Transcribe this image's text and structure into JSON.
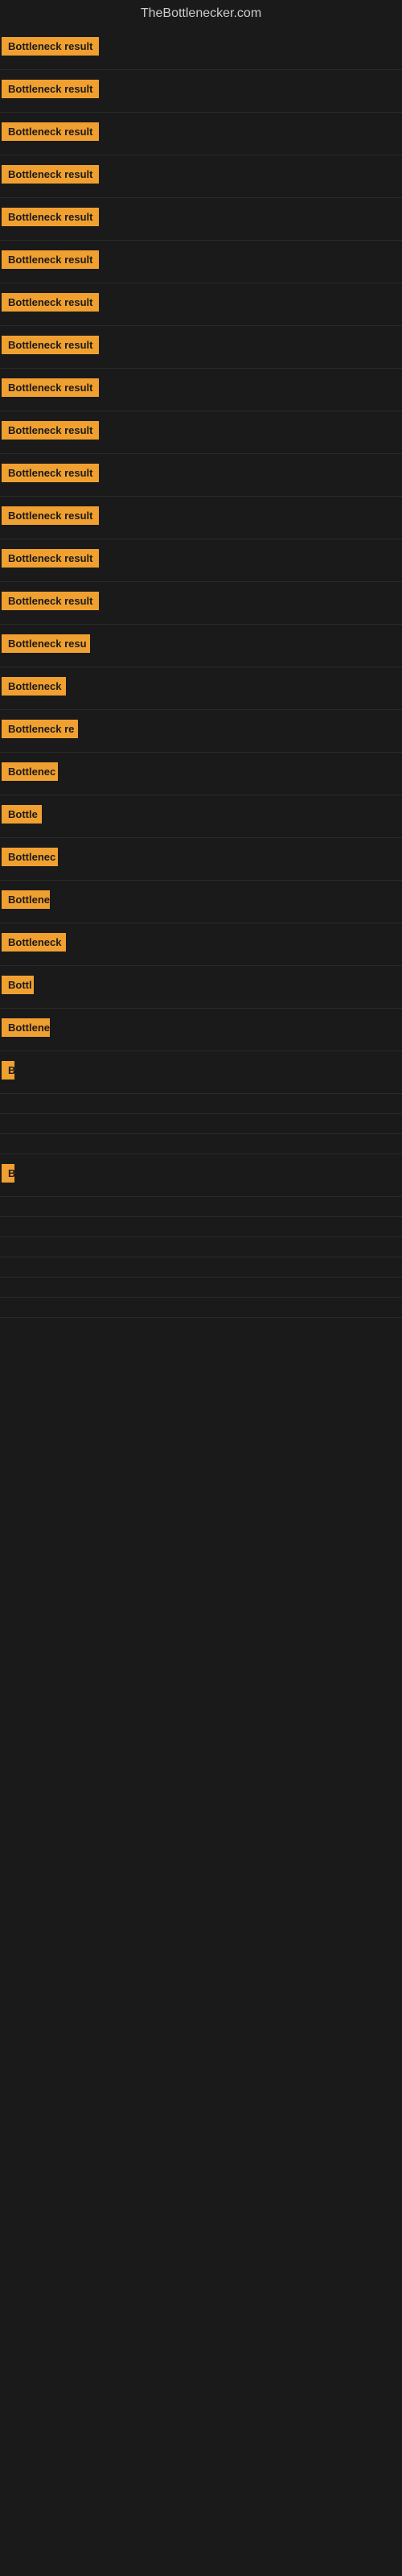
{
  "site": {
    "title": "TheBottlenecker.com"
  },
  "rows": [
    {
      "label": "Bottleneck result",
      "width": 130
    },
    {
      "label": "Bottleneck result",
      "width": 130
    },
    {
      "label": "Bottleneck result",
      "width": 130
    },
    {
      "label": "Bottleneck result",
      "width": 130
    },
    {
      "label": "Bottleneck result",
      "width": 130
    },
    {
      "label": "Bottleneck result",
      "width": 130
    },
    {
      "label": "Bottleneck result",
      "width": 130
    },
    {
      "label": "Bottleneck result",
      "width": 130
    },
    {
      "label": "Bottleneck result",
      "width": 130
    },
    {
      "label": "Bottleneck result",
      "width": 130
    },
    {
      "label": "Bottleneck result",
      "width": 130
    },
    {
      "label": "Bottleneck result",
      "width": 130
    },
    {
      "label": "Bottleneck result",
      "width": 130
    },
    {
      "label": "Bottleneck result",
      "width": 130
    },
    {
      "label": "Bottleneck resu",
      "width": 110
    },
    {
      "label": "Bottleneck",
      "width": 80
    },
    {
      "label": "Bottleneck re",
      "width": 95
    },
    {
      "label": "Bottlenec",
      "width": 70
    },
    {
      "label": "Bottle",
      "width": 50
    },
    {
      "label": "Bottlenec",
      "width": 70
    },
    {
      "label": "Bottlene",
      "width": 60
    },
    {
      "label": "Bottleneck",
      "width": 80
    },
    {
      "label": "Bottl",
      "width": 40
    },
    {
      "label": "Bottlene",
      "width": 60
    },
    {
      "label": "B",
      "width": 14
    },
    {
      "label": "",
      "width": 0
    },
    {
      "label": "",
      "width": 0
    },
    {
      "label": "",
      "width": 0
    },
    {
      "label": "B",
      "width": 14
    },
    {
      "label": "",
      "width": 0
    },
    {
      "label": "",
      "width": 0
    },
    {
      "label": "",
      "width": 0
    },
    {
      "label": "",
      "width": 0
    },
    {
      "label": "",
      "width": 0
    },
    {
      "label": "",
      "width": 0
    }
  ]
}
